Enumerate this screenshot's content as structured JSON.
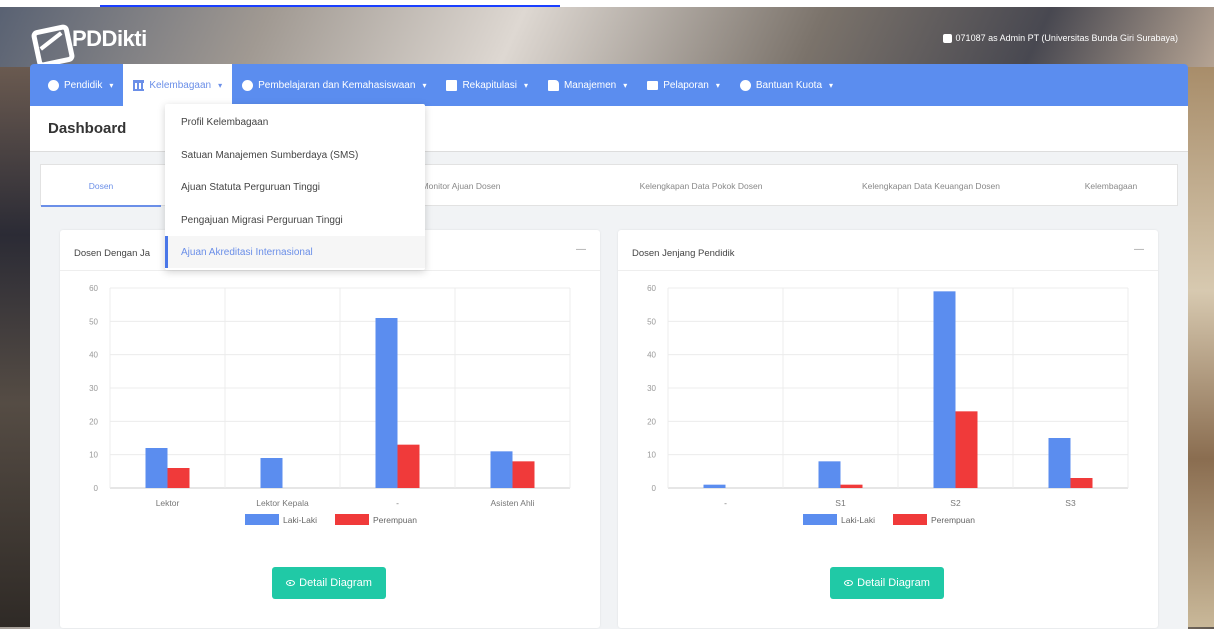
{
  "brand": {
    "name": "PDDikti"
  },
  "user": {
    "label": "071087 as Admin PT (Universitas Bunda Giri Surabaya)"
  },
  "nav": [
    {
      "label": "Pendidik",
      "icon": "user-circle-icon"
    },
    {
      "label": "Kelembagaan",
      "icon": "institution-icon"
    },
    {
      "label": "Pembelajaran dan Kemahasiswaan",
      "icon": "user-circle-icon"
    },
    {
      "label": "Rekapitulasi",
      "icon": "table-icon"
    },
    {
      "label": "Manajemen",
      "icon": "document-icon"
    },
    {
      "label": "Pelaporan",
      "icon": "folder-icon"
    },
    {
      "label": "Bantuan Kuota",
      "icon": "user-circle-icon"
    }
  ],
  "page": {
    "title": "Dashboard"
  },
  "dropdown": [
    "Profil Kelembagaan",
    "Satuan Manajemen Sumberdaya (SMS)",
    "Ajuan Statuta Perguruan Tinggi",
    "Pengajuan Migrasi Perguruan Tinggi",
    "Ajuan Akreditasi Internasional"
  ],
  "tabs": [
    "Dosen",
    "Monitor Ajuan Dosen",
    "Kelengkapan Data Pokok Dosen",
    "Kelengkapan Data Keuangan Dosen",
    "Kelembagaan"
  ],
  "colors": {
    "male": "#5b8def",
    "female": "#f03a3a",
    "nav": "#5b8def",
    "button": "#20c9a6"
  },
  "detail_button": "Detail Diagram",
  "chart_data": [
    {
      "type": "bar",
      "title": "Dosen Dengan Ja",
      "categories": [
        "Lektor",
        "Lektor Kepala",
        "-",
        "Asisten Ahli"
      ],
      "series": [
        {
          "name": "Laki-Laki",
          "values": [
            12,
            9,
            51,
            11
          ]
        },
        {
          "name": "Perempuan",
          "values": [
            6,
            0,
            13,
            8
          ]
        }
      ],
      "ylim": [
        0,
        60
      ],
      "yticks": [
        0,
        10,
        20,
        30,
        40,
        50,
        60
      ],
      "grid": true,
      "legend": "bottom"
    },
    {
      "type": "bar",
      "title": "Dosen Jenjang Pendidik",
      "categories": [
        "-",
        "S1",
        "S2",
        "S3"
      ],
      "series": [
        {
          "name": "Laki-Laki",
          "values": [
            1,
            8,
            59,
            15
          ]
        },
        {
          "name": "Perempuan",
          "values": [
            0,
            1,
            23,
            3
          ]
        }
      ],
      "ylim": [
        0,
        60
      ],
      "yticks": [
        0,
        10,
        20,
        30,
        40,
        50,
        60
      ],
      "grid": true,
      "legend": "bottom"
    }
  ]
}
